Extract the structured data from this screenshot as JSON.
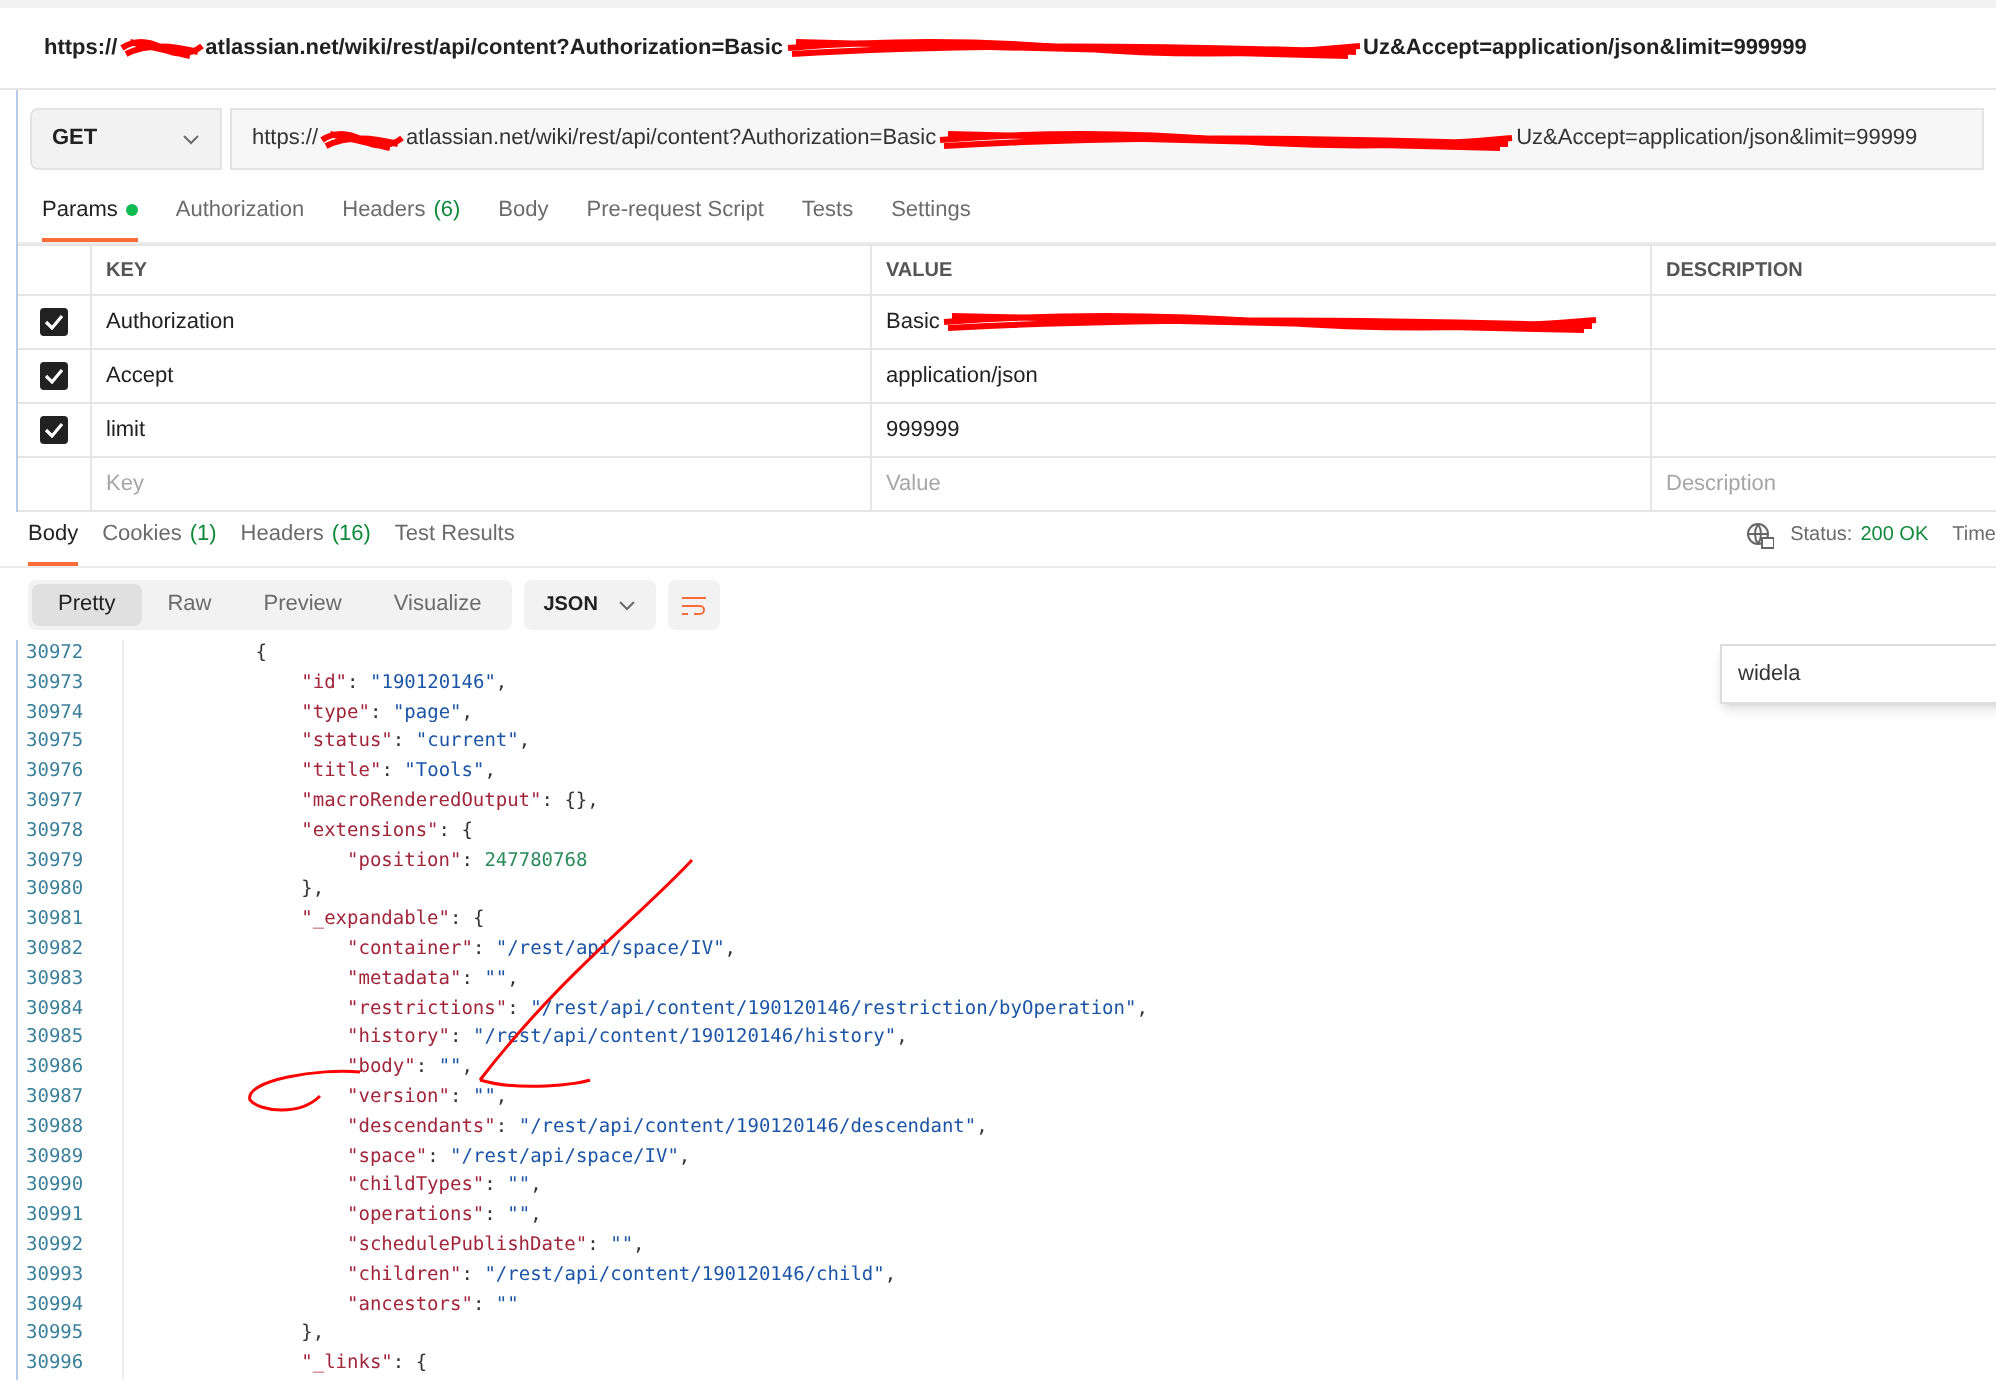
{
  "title_url": {
    "parts": [
      "https://",
      "atlassian.net/wiki/rest/api/content?Authorization=Basic",
      "Uz&Accept=application/json&limit=999999"
    ]
  },
  "request": {
    "method": "GET",
    "url_parts": [
      "https://",
      "atlassian.net/wiki/rest/api/content?Authorization=Basic",
      "Uz&Accept=application/json&limit=99999"
    ]
  },
  "request_tabs": [
    {
      "label": "Params",
      "dot": true,
      "selected": true
    },
    {
      "label": "Authorization",
      "dot": false,
      "selected": false
    },
    {
      "label": "Headers",
      "count": "(6)",
      "dot": false,
      "selected": false
    },
    {
      "label": "Body",
      "dot": false,
      "selected": false
    },
    {
      "label": "Pre-request Script",
      "dot": false,
      "selected": false
    },
    {
      "label": "Tests",
      "dot": false,
      "selected": false
    },
    {
      "label": "Settings",
      "dot": false,
      "selected": false
    }
  ],
  "params": {
    "columns": [
      "KEY",
      "VALUE",
      "DESCRIPTION"
    ],
    "rows": [
      {
        "key": "Authorization",
        "value": "Basic",
        "redacted": true,
        "checked": true
      },
      {
        "key": "Accept",
        "value": "application/json",
        "redacted": false,
        "checked": true
      },
      {
        "key": "limit",
        "value": "999999",
        "redacted": false,
        "checked": true
      }
    ],
    "placeholders": [
      "Key",
      "Value",
      "Description"
    ]
  },
  "response_tabs": [
    {
      "label": "Body",
      "selected": true
    },
    {
      "label": "Cookies",
      "count": "(1)",
      "selected": false
    },
    {
      "label": "Headers",
      "count": "(16)",
      "selected": false
    },
    {
      "label": "Test Results",
      "selected": false
    }
  ],
  "status": {
    "label": "Status:",
    "value": "200 OK",
    "next": "Time"
  },
  "view_modes": [
    {
      "label": "Pretty",
      "selected": true
    },
    {
      "label": "Raw",
      "selected": false
    },
    {
      "label": "Preview",
      "selected": false
    },
    {
      "label": "Visualize",
      "selected": false
    }
  ],
  "format": "JSON",
  "find": {
    "value": "widela"
  },
  "code_lines": [
    {
      "num": "30972",
      "text": "        {"
    },
    {
      "num": "30973",
      "text": "            \"id\": \"190120146\","
    },
    {
      "num": "30974",
      "text": "            \"type\": \"page\","
    },
    {
      "num": "30975",
      "text": "            \"status\": \"current\","
    },
    {
      "num": "30976",
      "text": "            \"title\": \"Tools\","
    },
    {
      "num": "30977",
      "text": "            \"macroRenderedOutput\": {},"
    },
    {
      "num": "30978",
      "text": "            \"extensions\": {"
    },
    {
      "num": "30979",
      "text": "                \"position\": 247780768"
    },
    {
      "num": "30980",
      "text": "            },"
    },
    {
      "num": "30981",
      "text": "            \"_expandable\": {"
    },
    {
      "num": "30982",
      "text": "                \"container\": \"/rest/api/space/IV\","
    },
    {
      "num": "30983",
      "text": "                \"metadata\": \"\","
    },
    {
      "num": "30984",
      "text": "                \"restrictions\": \"/rest/api/content/190120146/restriction/byOperation\","
    },
    {
      "num": "30985",
      "text": "                \"history\": \"/rest/api/content/190120146/history\","
    },
    {
      "num": "30986",
      "text": "                \"body\": \"\","
    },
    {
      "num": "30987",
      "text": "                \"version\": \"\","
    },
    {
      "num": "30988",
      "text": "                \"descendants\": \"/rest/api/content/190120146/descendant\","
    },
    {
      "num": "30989",
      "text": "                \"space\": \"/rest/api/space/IV\","
    },
    {
      "num": "30990",
      "text": "                \"childTypes\": \"\","
    },
    {
      "num": "30991",
      "text": "                \"operations\": \"\","
    },
    {
      "num": "30992",
      "text": "                \"schedulePublishDate\": \"\","
    },
    {
      "num": "30993",
      "text": "                \"children\": \"/rest/api/content/190120146/child\","
    },
    {
      "num": "30994",
      "text": "                \"ancestors\": \"\""
    },
    {
      "num": "30995",
      "text": "            },"
    },
    {
      "num": "30996",
      "text": "            \"_links\": {"
    }
  ]
}
